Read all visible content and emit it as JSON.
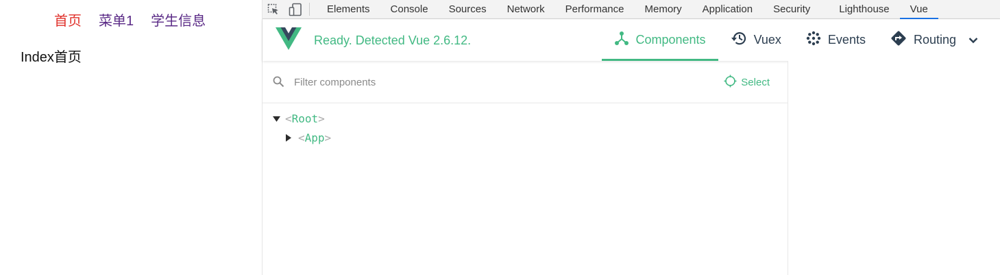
{
  "page": {
    "nav": [
      {
        "label": "首页",
        "color": "#e0302a"
      },
      {
        "label": "菜单1",
        "color": "#5a2a86"
      },
      {
        "label": "学生信息",
        "color": "#5a2a86"
      }
    ],
    "content": "Index首页"
  },
  "devtools": {
    "tools": [
      "inspect-element-icon",
      "device-toggle-icon"
    ],
    "tabs": [
      "Elements",
      "Console",
      "Sources",
      "Network",
      "Performance",
      "Memory",
      "Application",
      "Security",
      "Lighthouse",
      "Vue"
    ],
    "active_tab": "Vue",
    "active_color": "#1a73e8"
  },
  "vue": {
    "status": "Ready. Detected Vue 2.6.12.",
    "accent": "#42b983",
    "tabs": {
      "components": "Components",
      "vuex": "Vuex",
      "events": "Events",
      "routing": "Routing"
    },
    "filter": {
      "placeholder": "Filter components",
      "value": ""
    },
    "select_label": "Select",
    "tree": {
      "root": {
        "open": "<",
        "name": "Root",
        "close": ">"
      },
      "app": {
        "open": "<",
        "name": "App",
        "close": ">"
      }
    }
  }
}
